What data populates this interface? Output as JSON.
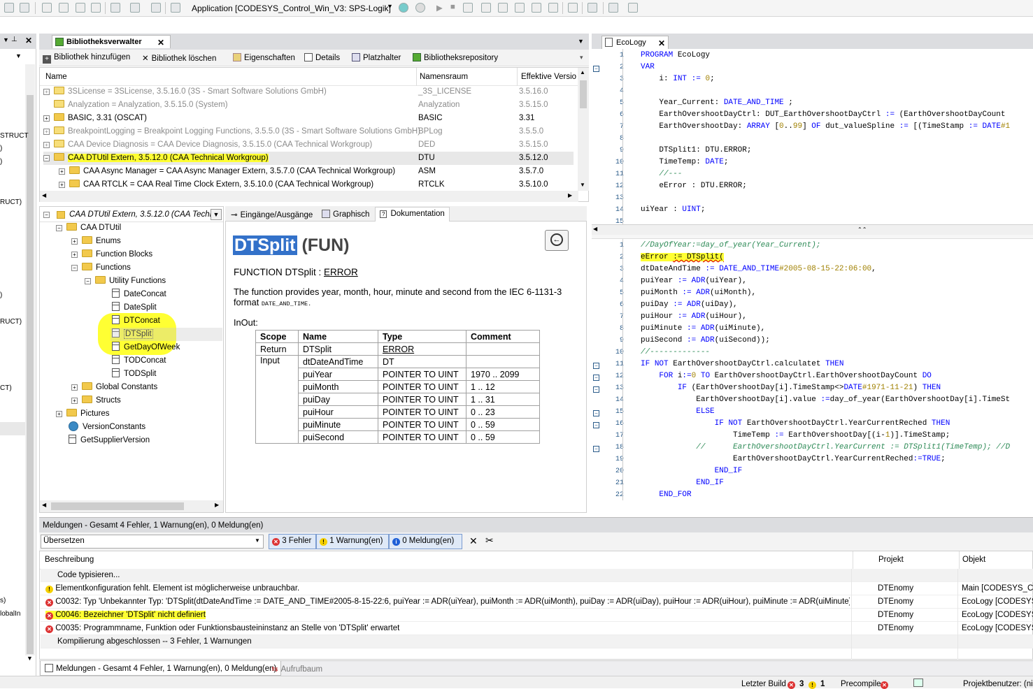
{
  "toolbar": {
    "app_title": "Application [CODESYS_Control_Win_V3: SPS-Logik]"
  },
  "library_manager": {
    "tab_label": "Bibliotheksverwalter",
    "actions": [
      "Bibliothek hinzufügen",
      "Bibliothek löschen",
      "Eigenschaften",
      "Details",
      "Platzhalter",
      "Bibliotheksrepository"
    ],
    "columns": [
      "Name",
      "Namensraum",
      "Effektive Versio"
    ],
    "rows": [
      {
        "name": "3SLicense = 3SLicense, 3.5.16.0 (3S - Smart Software Solutions GmbH)",
        "ns": "_3S_LICENSE",
        "ver": "3.5.16.0"
      },
      {
        "name": "Analyzation = Analyzation, 3.5.15.0 (System)",
        "ns": "Analyzation",
        "ver": "3.5.15.0"
      },
      {
        "name": "BASIC, 3.31 (OSCAT)",
        "ns": "BASIC",
        "ver": "3.31"
      },
      {
        "name": "BreakpointLogging = Breakpoint Logging Functions, 3.5.5.0 (3S - Smart Software Solutions GmbH)",
        "ns": "BPLog",
        "ver": "3.5.5.0"
      },
      {
        "name": "CAA Device Diagnosis = CAA Device Diagnosis, 3.5.15.0 (CAA Technical Workgroup)",
        "ns": "DED",
        "ver": "3.5.15.0"
      },
      {
        "name": "CAA DTUtil Extern, 3.5.12.0 (CAA Technical Workgroup)",
        "ns": "DTU",
        "ver": "3.5.12.0"
      },
      {
        "name": "CAA Async Manager = CAA Async Manager Extern, 3.5.7.0 (CAA Technical Workgroup)",
        "ns": "ASM",
        "ver": "3.5.7.0"
      },
      {
        "name": "CAA RTCLK = CAA Real Time Clock Extern, 3.5.10.0 (CAA Technical Workgroup)",
        "ns": "RTCLK",
        "ver": "3.5.10.0"
      }
    ]
  },
  "tree": {
    "root": "CAA DTUtil Extern, 3.5.12.0 (CAA Techni",
    "items": [
      "CAA DTUtil",
      "Enums",
      "Function Blocks",
      "Functions",
      "Utility Functions",
      "DateConcat",
      "DateSplit",
      "DTConcat",
      "DTSplit",
      "GetDayOfWeek",
      "TODConcat",
      "TODSplit",
      "Global Constants",
      "Structs",
      "Pictures",
      "VersionConstants",
      "GetSupplierVersion"
    ]
  },
  "doc_tabs": [
    "Eingänge/Ausgänge",
    "Graphisch",
    "Dokumentation"
  ],
  "doc": {
    "title_name": "DTSplit",
    "title_kind": "(FUN)",
    "signature_prefix": "FUNCTION DTSplit : ",
    "signature_type": "ERROR",
    "description": "The function provides year, month, hour, minute and second from the IEC 6-1131-3 format ",
    "description_code": "DATE_AND_TIME.",
    "inout_label": "InOut:",
    "table_headers": [
      "Scope",
      "Name",
      "Type",
      "Comment"
    ],
    "table_rows": [
      [
        "Return",
        "DTSplit",
        "ERROR",
        ""
      ],
      [
        "Input",
        "dtDateAndTime",
        "DT",
        ""
      ],
      [
        "",
        "puiYear",
        "POINTER TO UINT",
        "1970 .. 2099"
      ],
      [
        "",
        "puiMonth",
        "POINTER TO UINT",
        "1 .. 12"
      ],
      [
        "",
        "puiDay",
        "POINTER TO UINT",
        "1 .. 31"
      ],
      [
        "",
        "puiHour",
        "POINTER TO UINT",
        "0 .. 23"
      ],
      [
        "",
        "puiMinute",
        "POINTER TO UINT",
        "0 .. 59"
      ],
      [
        "",
        "puiSecond",
        "POINTER TO UINT",
        "0 .. 59"
      ]
    ]
  },
  "editor": {
    "tab_label": "EcoLogy",
    "decl_lines": [
      [
        "1",
        "PROGRAM EcoLogy"
      ],
      [
        "2",
        "VAR"
      ],
      [
        "3",
        "    i: INT := 0;"
      ],
      [
        "4",
        ""
      ],
      [
        "5",
        "    Year_Current: DATE_AND_TIME ;"
      ],
      [
        "6",
        "    EarthOvershootDayCtrl: DUT_EarthOvershootDayCtrl := (EarthOvershootDayCount"
      ],
      [
        "7",
        "    EarthOvershootDay: ARRAY [0..99] OF dut_valueSpline := [(TimeStamp := DATE#1"
      ],
      [
        "8",
        ""
      ],
      [
        "9",
        "    DTSplit1: DTU.ERROR;"
      ],
      [
        "10",
        "    TimeTemp: DATE;"
      ],
      [
        "11",
        "    //---"
      ],
      [
        "12",
        "    eError : DTU.ERROR;"
      ],
      [
        "13",
        ""
      ],
      [
        "14",
        "uiYear : UINT;"
      ],
      [
        "15",
        ""
      ]
    ],
    "impl_lines": [
      [
        "1",
        "//DayOfYear:=day_of_year(Year_Current);"
      ],
      [
        "2",
        "eError := DTSplit("
      ],
      [
        "3",
        "dtDateAndTime := DATE_AND_TIME#2005-08-15-22:06:00,"
      ],
      [
        "4",
        "puiYear := ADR(uiYear),"
      ],
      [
        "5",
        "puiMonth := ADR(uiMonth),"
      ],
      [
        "6",
        "puiDay := ADR(uiDay),"
      ],
      [
        "7",
        "puiHour := ADR(uiHour),"
      ],
      [
        "8",
        "puiMinute := ADR(uiMinute),"
      ],
      [
        "9",
        "puiSecond := ADR(uiSecond));"
      ],
      [
        "10",
        "//-------------"
      ],
      [
        "11",
        "IF NOT EarthOvershootDayCtrl.calculatet THEN"
      ],
      [
        "12",
        "    FOR i:=0 TO EarthOvershootDayCtrl.EarthOvershootDayCount DO"
      ],
      [
        "13",
        "        IF (EarthOvershootDay[i].TimeStamp<>DATE#1971-11-21) THEN"
      ],
      [
        "14",
        "            EarthOvershootDay[i].value :=day_of_year(EarthOvershootDay[i].TimeSt"
      ],
      [
        "15",
        "            ELSE"
      ],
      [
        "16",
        "                IF NOT EarthOvershootDayCtrl.YearCurrentReched THEN"
      ],
      [
        "17",
        "                    TimeTemp := EarthOvershootDay[(i-1)].TimeStamp;"
      ],
      [
        "18",
        "            //      EarthOvershootDayCtrl.YearCurrent := DTSplit1(TimeTemp); //D"
      ],
      [
        "19",
        "                    EarthOvershootDayCtrl.YearCurrentReched:=TRUE;"
      ],
      [
        "20",
        "                END_IF"
      ],
      [
        "21",
        "            END_IF"
      ],
      [
        "22",
        "    END_FOR"
      ]
    ]
  },
  "messages": {
    "header": "Meldungen - Gesamt 4 Fehler, 1 Warnung(en), 0 Meldung(en)",
    "category": "Übersetzen",
    "filter_errors": "3 Fehler",
    "filter_warnings": "1 Warnung(en)",
    "filter_infos": "0 Meldung(en)",
    "columns": [
      "Beschreibung",
      "Projekt",
      "Objekt"
    ],
    "rows": [
      {
        "type": "none",
        "desc": "Code typisieren...",
        "proj": "",
        "obj": ""
      },
      {
        "type": "warn",
        "desc": "Elementkonfiguration fehlt. Element ist möglicherweise unbrauchbar.",
        "proj": "DTEnomy",
        "obj": "Main [CODESYS_Co..."
      },
      {
        "type": "err",
        "desc": "C0032:  Typ 'Unbekannter Typ: 'DTSplit(dtDateAndTime := DATE_AND_TIME#2005-8-15-22:6, puiYear := ADR(uiYear), puiMonth := ADR(uiMonth), puiDay := ADR(uiDay), puiHour := ADR(uiHour), puiMinute := ADR(uiMinute), puiSe...",
        "proj": "DTEnomy",
        "obj": "EcoLogy [CODESYS_..."
      },
      {
        "type": "err",
        "desc": "C0046:  Bezeichner 'DTSplit' nicht definiert",
        "proj": "DTEnomy",
        "obj": "EcoLogy [CODESYS_..."
      },
      {
        "type": "err",
        "desc": "C0035:  Programmname, Funktion oder Funktionsbausteininstanz an Stelle von 'DTSplit' erwartet",
        "proj": "DTEnomy",
        "obj": "EcoLogy [CODESYS_..."
      },
      {
        "type": "none",
        "desc": "Kompilierung abgeschlossen -- 3 Fehler, 1 Warnungen",
        "proj": "",
        "obj": ""
      }
    ]
  },
  "bottom_tabs": [
    "Meldungen - Gesamt 4 Fehler, 1 Warnung(en), 0 Meldung(en)",
    "Aufrufbaum"
  ],
  "status": {
    "last_build": "Letzter Build",
    "errors": "3",
    "warnings": "1",
    "precompile": "Precompile",
    "user": "Projektbenutzer: (ni"
  },
  "left_edge": [
    "STRUCT",
    ")",
    ")",
    "RUCT)",
    ")",
    "RUCT)",
    "CT)",
    "s)",
    "lobalIn"
  ]
}
